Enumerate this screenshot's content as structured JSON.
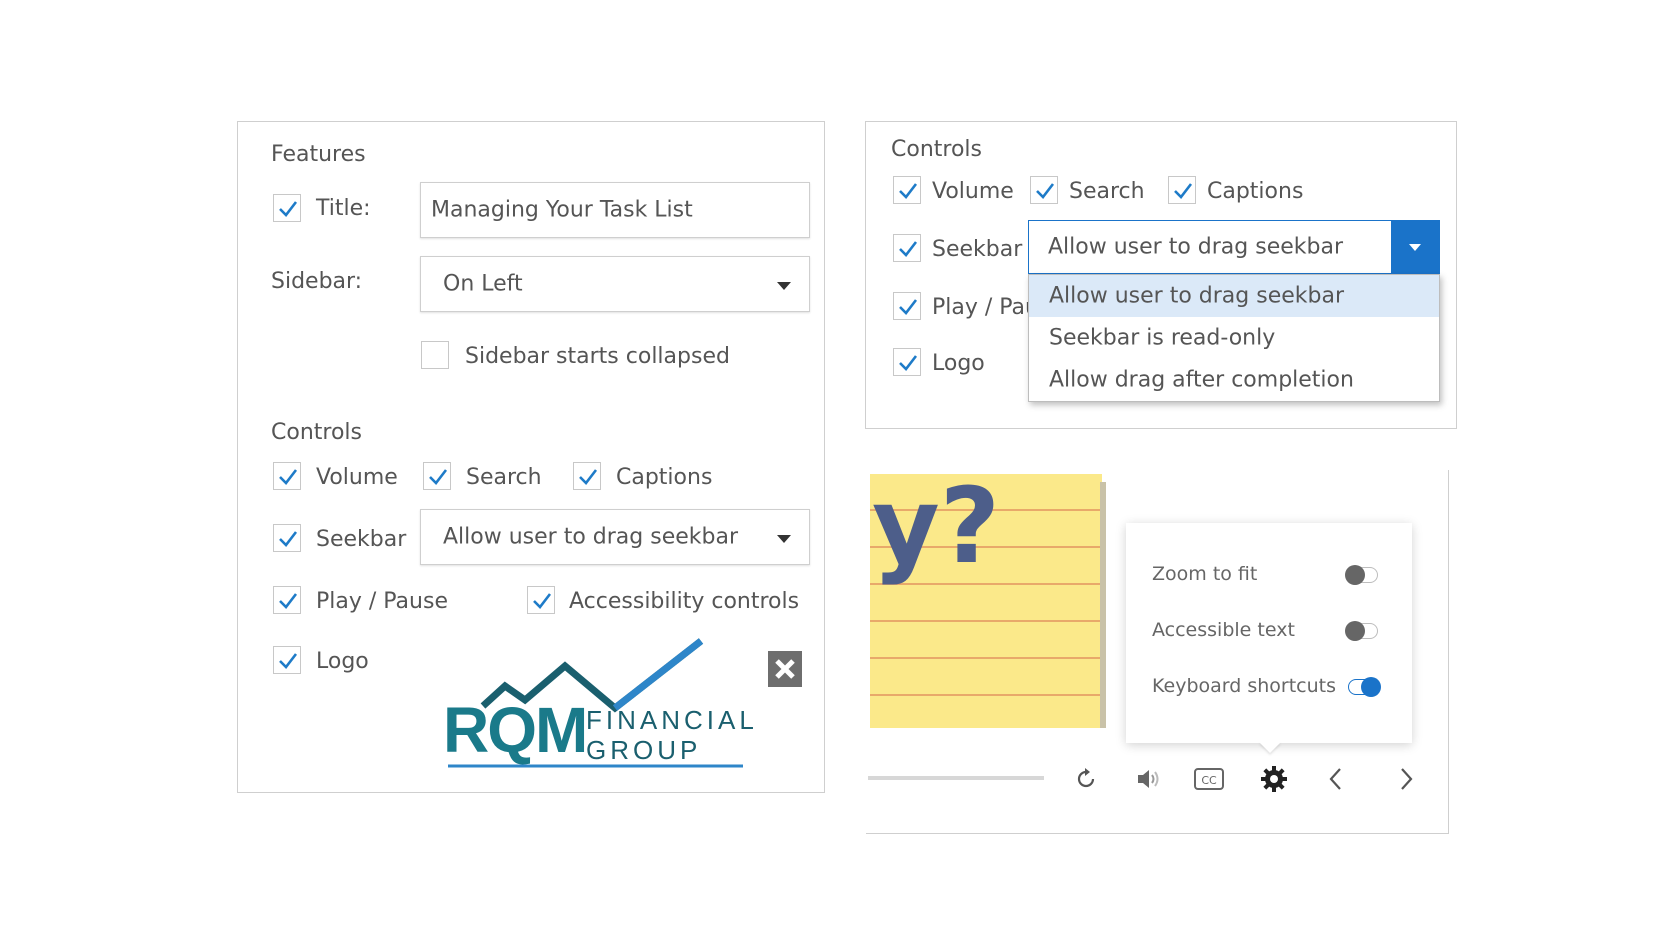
{
  "left_panel": {
    "features_heading": "Features",
    "title_label": "Title:",
    "title_value": "Managing Your Task List",
    "sidebar_label": "Sidebar:",
    "sidebar_value": "On Left",
    "sidebar_collapsed_label": "Sidebar starts collapsed",
    "controls_heading": "Controls",
    "volume_label": "Volume",
    "search_label": "Search",
    "captions_label": "Captions",
    "seekbar_label": "Seekbar",
    "seekbar_value": "Allow user to drag seekbar",
    "playpause_label": "Play / Pause",
    "accessibility_label": "Accessibility controls",
    "logo_label": "Logo",
    "logo_main": "RQM",
    "logo_line1": "FINANCIAL",
    "logo_line2": "GROUP"
  },
  "right_top_panel": {
    "controls_heading": "Controls",
    "volume_label": "Volume",
    "search_label": "Search",
    "captions_label": "Captions",
    "seekbar_label": "Seekbar",
    "seekbar_value": "Allow user to drag seekbar",
    "playpause_label": "Play / Paus",
    "logo_label": "Logo",
    "dropdown_options": [
      "Allow user to drag seekbar",
      "Seekbar is read-only",
      "Allow drag after completion"
    ]
  },
  "player": {
    "note_text": "y?",
    "settings": {
      "zoom_label": "Zoom to fit",
      "accessible_label": "Accessible text",
      "keyboard_label": "Keyboard shortcuts"
    }
  },
  "colors": {
    "accent": "#1a73c9",
    "check": "#1e7bc8",
    "note_yellow": "#fbe98a",
    "logo_teal": "#1a7a8a",
    "logo_blue": "#2e86c9"
  }
}
